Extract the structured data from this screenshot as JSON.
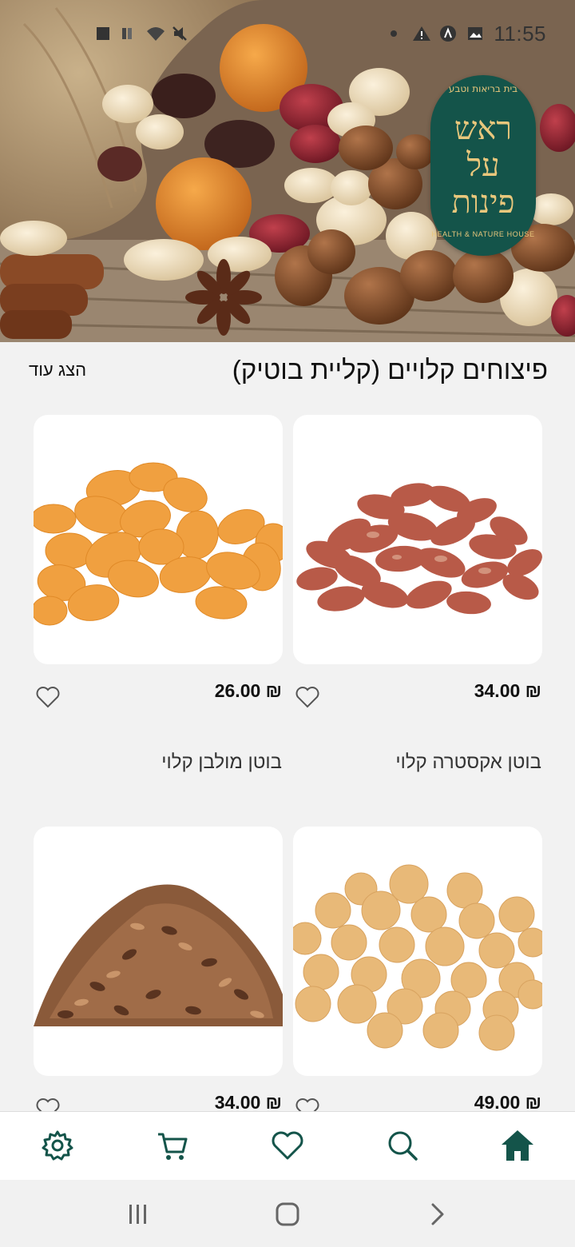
{
  "status_bar": {
    "time": "11:55",
    "icons": [
      "square-notification-icon",
      "sim-icon",
      "wifi-icon",
      "mute-icon",
      "dot-icon",
      "alert-icon",
      "app-icon",
      "image-icon"
    ]
  },
  "banner": {
    "logo": {
      "top_text": "בית בריאות וטבע",
      "mark_line1": "ראש",
      "mark_line2": "על",
      "mark_line3": "פינות",
      "bottom_text": "HEALTH & NATURE HOUSE"
    }
  },
  "section": {
    "title": "פיצוחים קלויים (קליית בוטיק)",
    "show_more_label": "הצג עוד"
  },
  "products": [
    {
      "name": "בוטן אקסטרה קלוי",
      "price": "34.00 ₪",
      "image": "red-skin-peanuts"
    },
    {
      "name": "בוטן מולבן קלוי",
      "price": "26.00 ₪",
      "image": "blanched-peanuts"
    },
    {
      "name": "",
      "price": "49.00 ₪",
      "image": "coated-peanuts"
    },
    {
      "name": "",
      "price": "34.00 ₪",
      "image": "roasted-seeds"
    }
  ],
  "bottom_nav": {
    "items": [
      {
        "name": "home",
        "icon": "home-icon",
        "active": true
      },
      {
        "name": "search",
        "icon": "search-icon",
        "active": false
      },
      {
        "name": "favorites",
        "icon": "heart-icon",
        "active": false
      },
      {
        "name": "cart",
        "icon": "cart-icon",
        "active": false
      },
      {
        "name": "settings",
        "icon": "gear-icon",
        "active": false
      }
    ]
  },
  "colors": {
    "brand": "#14544a",
    "logo_gold": "#e9c77c",
    "background": "#f2f2f2",
    "card": "#ffffff"
  }
}
